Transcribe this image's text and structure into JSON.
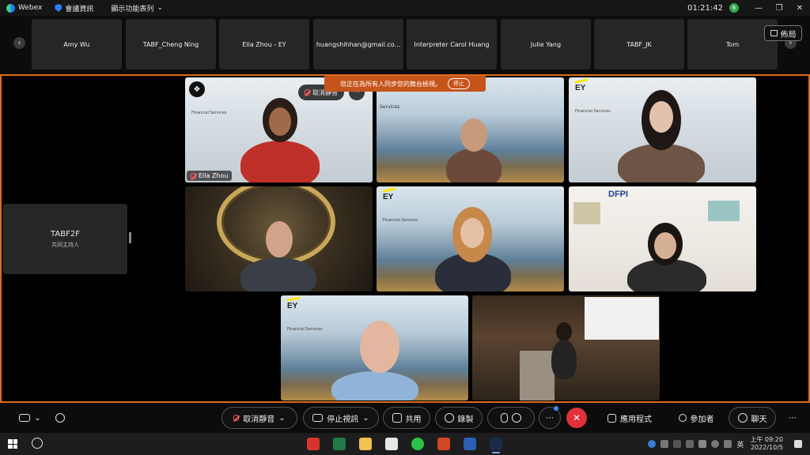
{
  "titlebar": {
    "app_name": "Webex",
    "meeting_info": "會議資訊",
    "view_menu": "顯示功能表列",
    "clock": "01:21:42",
    "badge": "6"
  },
  "strip": {
    "participants": [
      {
        "name": "Amy Wu"
      },
      {
        "name": "TABF_Cheng Ning"
      },
      {
        "name": "Ella Zhou - EY"
      },
      {
        "name": "huangshihhan@gmail.co..."
      },
      {
        "name": "Interpreter Carol Huang"
      },
      {
        "name": "Julie Yang"
      },
      {
        "name": "TABF_JK"
      },
      {
        "name": "Tom"
      }
    ],
    "layout_label": "佈局"
  },
  "stage": {
    "host": {
      "name": "TABF2F",
      "role": "共同主持人"
    },
    "sync_banner": {
      "text": "您正在為所有人同步您的舞台檢視。",
      "stop": "停止"
    },
    "unmute_pill": "取消靜音",
    "ella_tag": "Ella Zhou",
    "ey_logo": "EY",
    "ey_tagline": "Financial Services",
    "services_label": "Services",
    "dfpi_label": "DFPI"
  },
  "controls": {
    "unmute": "取消靜音",
    "stop_video": "停止視訊",
    "share": "共用",
    "record": "錄製",
    "apps": "應用程式",
    "participants": "參加者",
    "chat": "聊天"
  },
  "taskbar": {
    "time": "上午 09:20",
    "date": "2022/10/5",
    "ime": "英"
  },
  "colors": {
    "stage_border": "#e06a1c",
    "end_call": "#e0303a",
    "banner": "#c5541a"
  }
}
